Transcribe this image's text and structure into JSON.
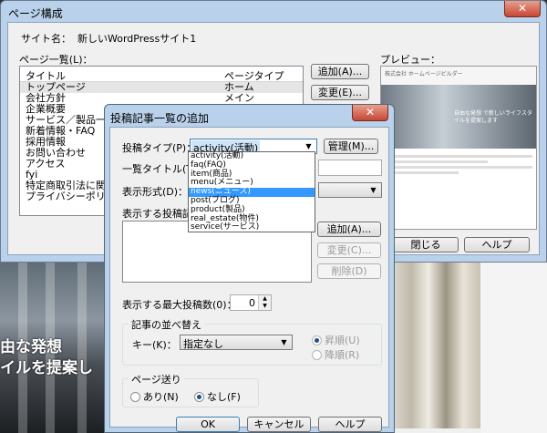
{
  "main_window": {
    "title": "ページ構成",
    "close": "✕",
    "site_label": "サイト名：",
    "site_name": "新しいWordPressサイト1",
    "pages_label": "ページ一覧(L)：",
    "columns": [
      "タイトル",
      "ページタイプ"
    ],
    "rows": [
      {
        "title": "トップページ",
        "type": "ホーム"
      },
      {
        "title": "会社方針",
        "type": "メイン"
      },
      {
        "title": "企業概要",
        "type": ""
      },
      {
        "title": "サービス／製品一覧",
        "type": ""
      },
      {
        "title": "新着情報・FAQ",
        "type": ""
      },
      {
        "title": "採用情報",
        "type": ""
      },
      {
        "title": "お問い合わせ",
        "type": ""
      },
      {
        "title": "アクセス",
        "type": ""
      },
      {
        "title": "fyi",
        "type": ""
      },
      {
        "title": "特定商取引法に関する",
        "type": ""
      },
      {
        "title": "プライバシーポリシー",
        "type": ""
      }
    ],
    "add_button": "追加(A)...",
    "edit_button": "変更(E)...",
    "preview_label": "プレビュー：",
    "preview_header": "株式会社 ホームページビルダー",
    "preview_hero": "自由な発想 で新しいライフスタイルを提案します",
    "close_button": "閉じる",
    "help_button": "ヘルプ"
  },
  "background": {
    "hero_line1": "由な発想",
    "hero_line2": "イルを提案し"
  },
  "dialog": {
    "title": "投稿記事一覧の追加",
    "close": "✕",
    "post_type_label": "投稿タイプ(P)：",
    "post_type_value": "activity(活動)",
    "manage_button": "管理(M)...",
    "list_title_label": "一覧タイトル(T)：",
    "display_format_label": "表示形式(D)：",
    "posts_label": "表示する投稿記事",
    "add_button": "追加(A)...",
    "edit_button": "変更(C)...",
    "delete_button": "削除(D)",
    "max_posts_label": "表示する最大投稿数(0)：",
    "max_posts_value": "0",
    "sort_group": "記事の並べ替え",
    "key_label": "キー(K)：",
    "key_value": "指定なし",
    "asc": "昇順(U)",
    "desc": "降順(R)",
    "paging_group": "ページ送り",
    "paging_yes": "あり(N)",
    "paging_no": "なし(F)",
    "ok_button": "OK",
    "cancel_button": "キャンセル",
    "help_button": "ヘルプ",
    "dropdown_options": [
      "activity(活動)",
      "faq(FAQ)",
      "item(商品)",
      "menu(メニュー)",
      "news(ニュース)",
      "post(ブログ)",
      "product(製品)",
      "real_estate(物件)",
      "service(サービス)"
    ],
    "dropdown_selected_index": 4
  },
  "icons": {
    "close": "close-icon",
    "dropdown": "chevron-down-icon",
    "spin": "spin-arrows-icon"
  }
}
